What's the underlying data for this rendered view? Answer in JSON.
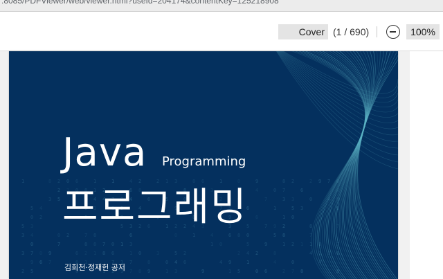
{
  "browser": {
    "url": ":8085/PDFViewer/web/viewer.html?useId=204174&contentKey=125218908"
  },
  "toolbar": {
    "page_label": "Cover",
    "page_count": "(1 / 690)",
    "zoom_level": "100%"
  },
  "cover": {
    "title_en": "Java",
    "subtitle_en": "Programming",
    "title_ko": "프로그래밍",
    "authors": "김희천·정재헌 공저"
  },
  "colors": {
    "cover_background": "#04305e",
    "wave_lines": "#5fb6c8",
    "digits": "#2f6a8f"
  }
}
